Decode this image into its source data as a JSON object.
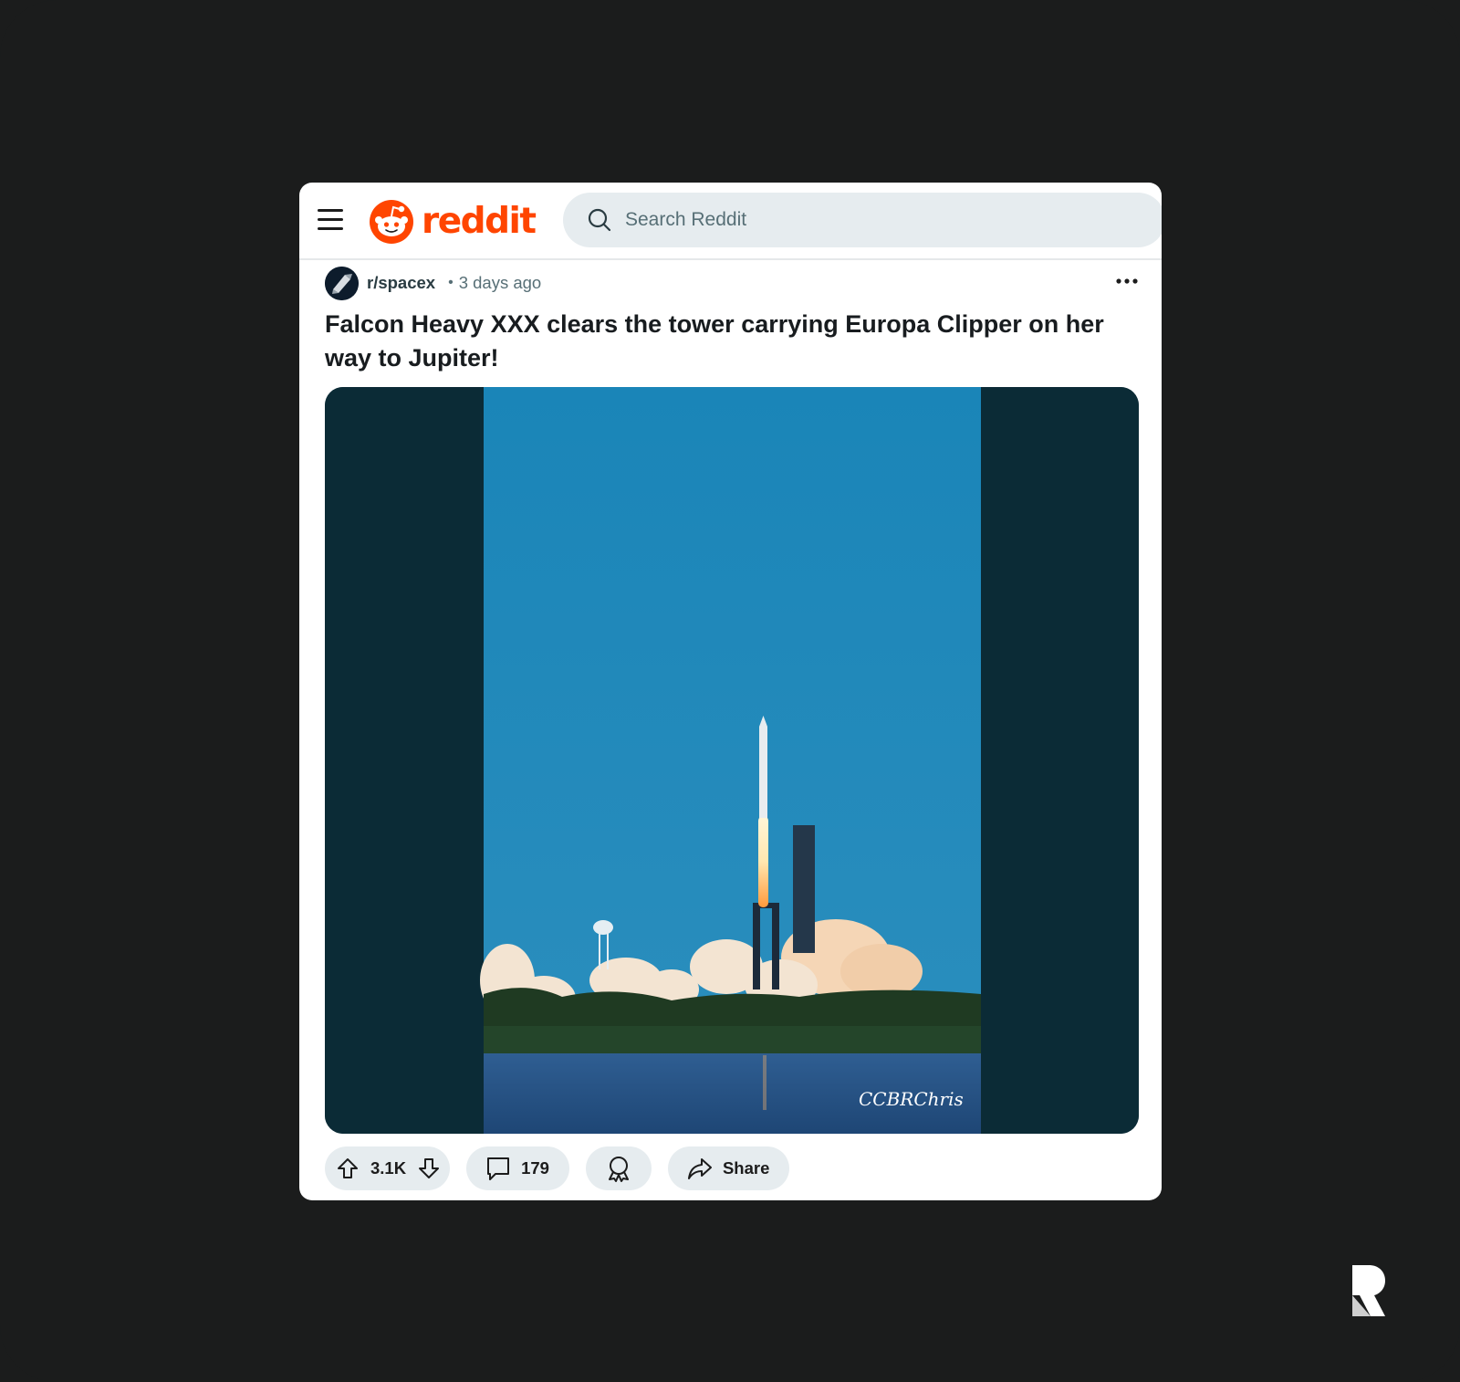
{
  "app": {
    "logo_text": "reddit",
    "brand_color": "#ff4500"
  },
  "search": {
    "placeholder": "Search Reddit"
  },
  "post": {
    "subreddit": "r/spacex",
    "separator": "•",
    "time_ago": "3 days ago",
    "title": "Falcon Heavy XXX clears the tower carrying Europa Clipper on her way to Jupiter!",
    "image_watermark": "CCBRChris"
  },
  "actions": {
    "score": "3.1K",
    "comments": "179",
    "share_label": "Share"
  },
  "icons": [
    "menu-icon",
    "reddit-snoo-icon",
    "search-icon",
    "more-options-icon",
    "upvote-icon",
    "downvote-icon",
    "comment-icon",
    "award-icon",
    "share-icon"
  ]
}
